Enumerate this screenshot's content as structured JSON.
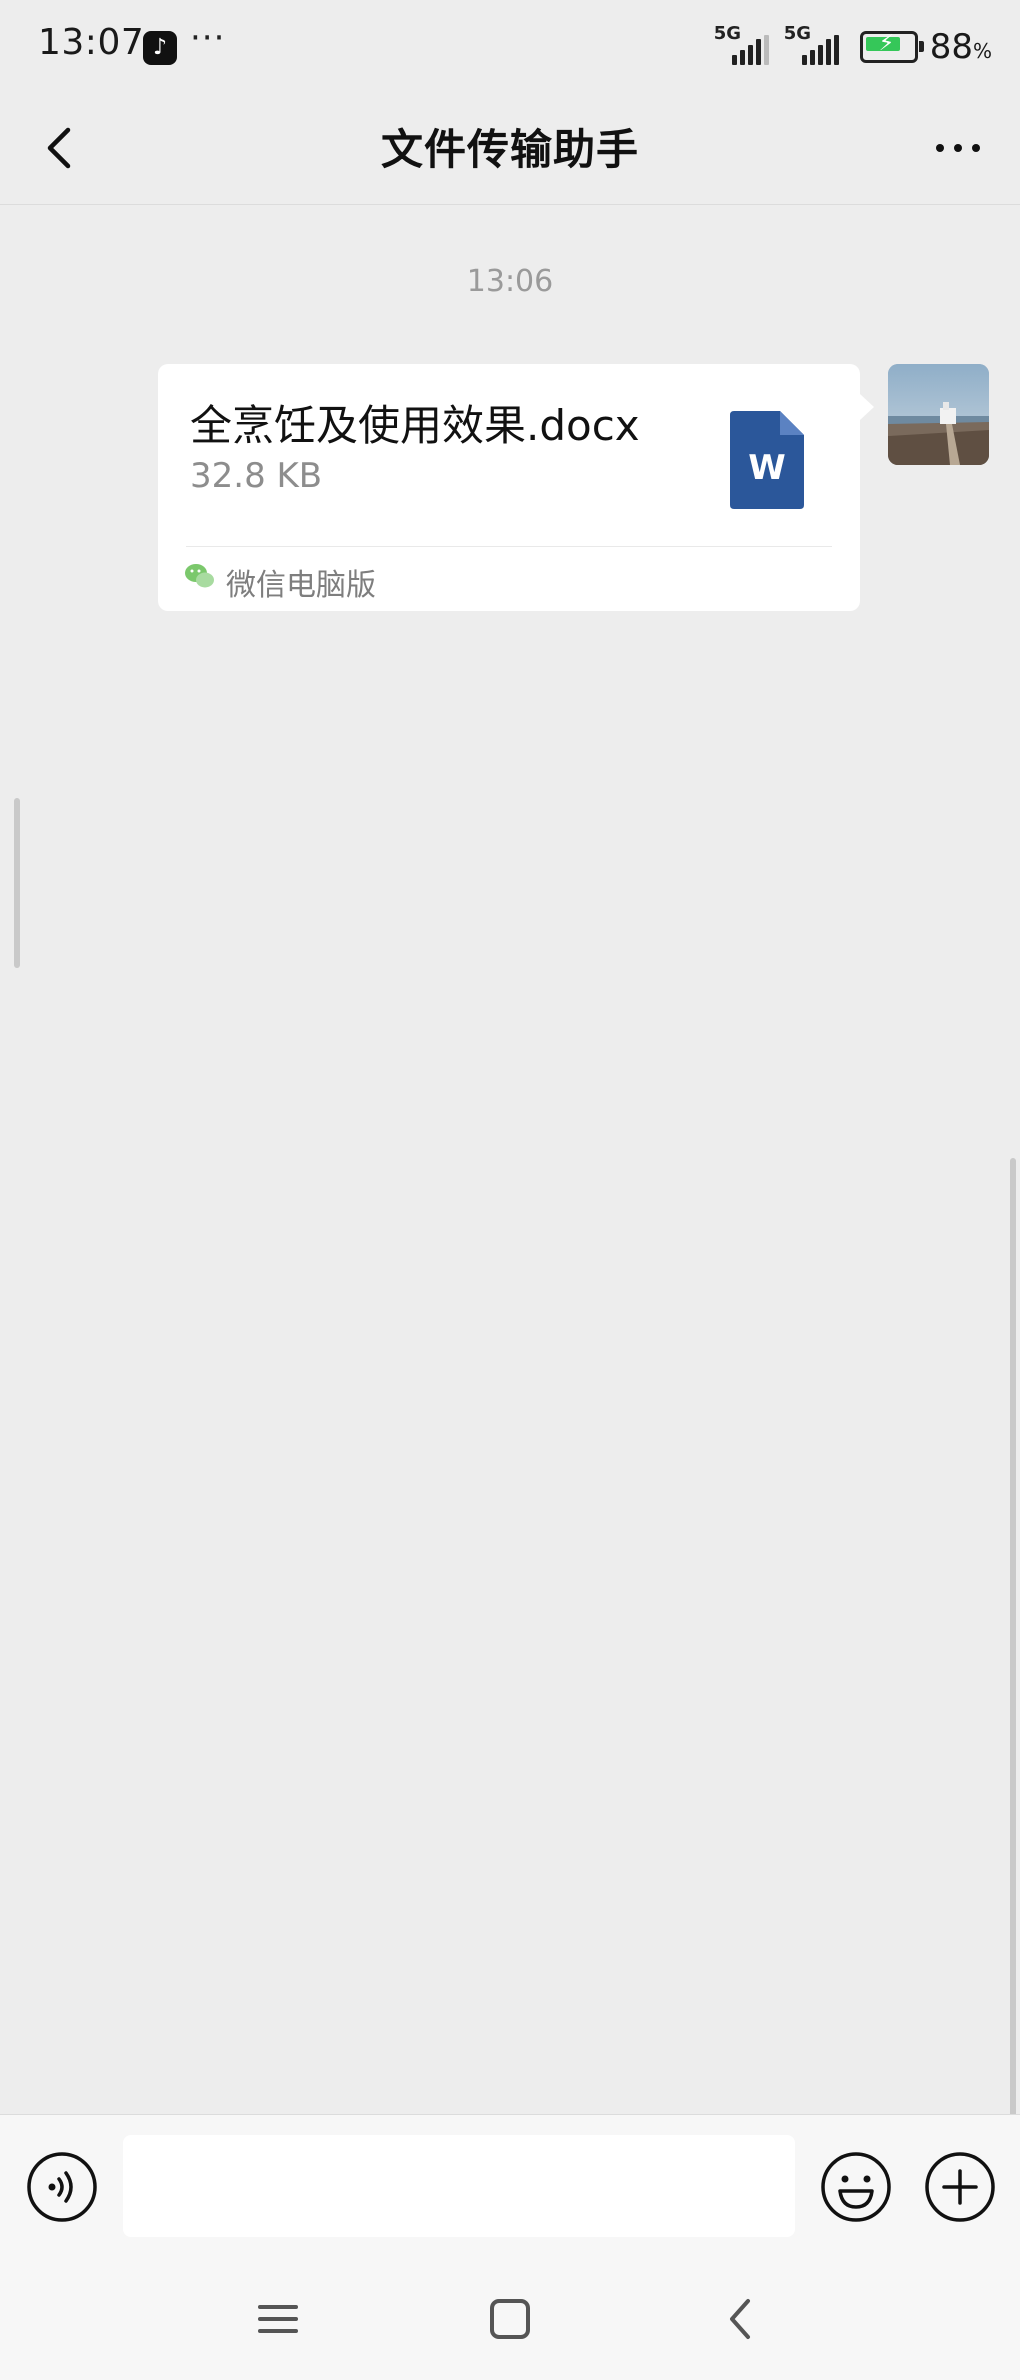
{
  "status_bar": {
    "time": "13:07",
    "app_icon_glyph": "♪",
    "app_icon": "tiktok-icon",
    "overflow_dots": "···",
    "signal1_label": "5G",
    "signal2_label": "5G",
    "battery_percent": "88",
    "battery_unit": "%",
    "battery_color": "#35c759"
  },
  "header": {
    "title": "文件传输助手",
    "back_icon": "chevron-left-icon",
    "more_icon": "more-horizontal-icon"
  },
  "chat": {
    "timestamp": "13:06",
    "message": {
      "file_name": "全烹饪及使用效果.docx",
      "file_size": "32.8 KB",
      "file_icon": "word-document-icon",
      "file_icon_letter": "W",
      "file_icon_color": "#2b579a",
      "source_label": "微信电脑版",
      "source_icon": "wechat-icon",
      "source_icon_color": "#7bc86c"
    }
  },
  "input_bar": {
    "voice_icon": "voice-icon",
    "text_value": "",
    "emoji_icon": "emoji-icon",
    "plus_icon": "plus-circle-icon"
  },
  "system_nav": {
    "menu_icon": "menu-icon",
    "home_icon": "home-square-icon",
    "back_icon": "back-arrow-icon"
  }
}
